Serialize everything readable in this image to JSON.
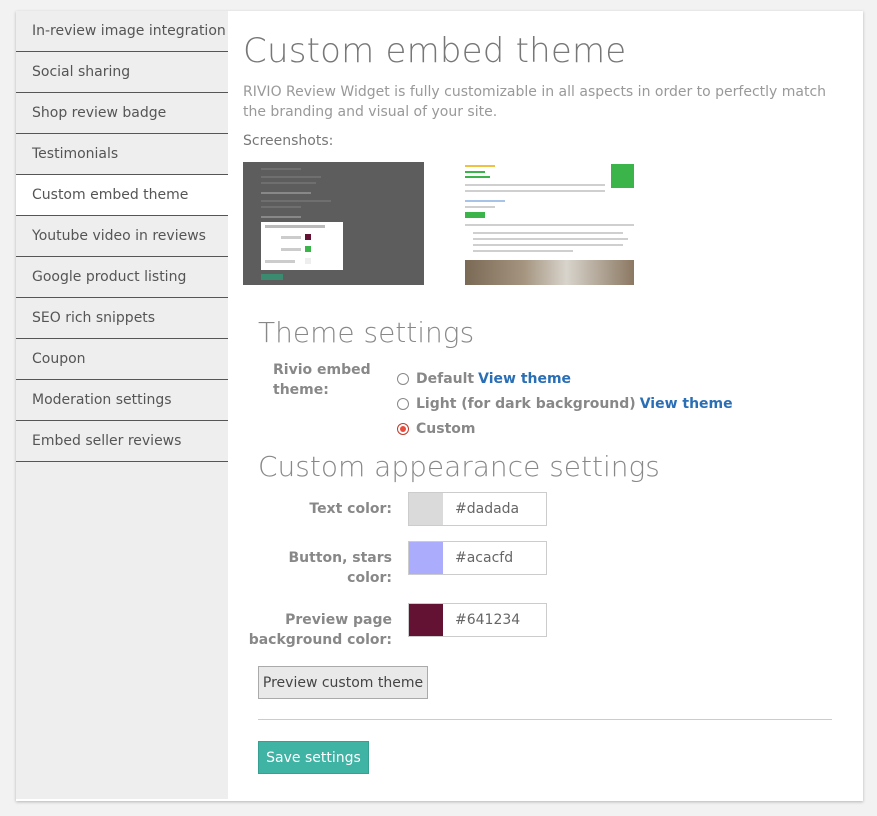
{
  "sidebar": {
    "items": [
      {
        "label": "In-review image integration"
      },
      {
        "label": "Social sharing"
      },
      {
        "label": "Shop review badge"
      },
      {
        "label": "Testimonials"
      },
      {
        "label": "Custom embed theme",
        "active": true
      },
      {
        "label": "Youtube video in reviews"
      },
      {
        "label": "Google product listing"
      },
      {
        "label": "SEO rich snippets"
      },
      {
        "label": "Coupon"
      },
      {
        "label": "Moderation settings"
      },
      {
        "label": "Embed seller reviews"
      }
    ]
  },
  "main": {
    "title": "Custom embed theme",
    "intro": "RIVIO Review Widget is fully customizable in all aspects in order to perfectly match the branding and visual of your site.",
    "screenshots_label": "Screenshots:"
  },
  "theme_settings": {
    "heading": "Theme settings",
    "label": "Rivio embed theme:",
    "options": [
      {
        "label": "Default",
        "link": "View theme",
        "checked": false
      },
      {
        "label": "Light (for dark background)",
        "link": "View theme",
        "checked": false
      },
      {
        "label": "Custom",
        "checked": true
      }
    ]
  },
  "appearance": {
    "heading": "Custom appearance settings",
    "fields": [
      {
        "label": "Text color:",
        "value": "#dadada"
      },
      {
        "label": "Button, stars color:",
        "value": "#acacfd"
      },
      {
        "label": "Preview page background color:",
        "value": "#641234"
      }
    ],
    "preview_button": "Preview custom theme",
    "save_button": "Save settings"
  },
  "colors": {
    "save_button": "#3fb3a4",
    "link": "#2a6fb5",
    "radio_selected": "#e74c3c"
  }
}
